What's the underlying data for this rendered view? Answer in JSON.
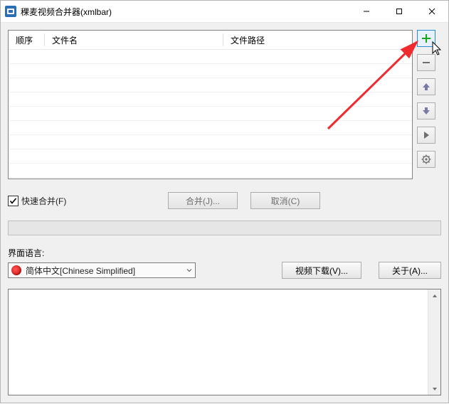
{
  "window": {
    "title": "稞麦视频合并器(xmlbar)"
  },
  "listview": {
    "columns": {
      "order": "顺序",
      "name": "文件名",
      "path": "文件路径"
    },
    "rows": []
  },
  "side_tools": {
    "add": "add-icon",
    "remove": "remove-icon",
    "move_up": "arrow-up-icon",
    "move_down": "arrow-down-icon",
    "play": "play-icon",
    "settings": "gear-icon"
  },
  "actions": {
    "fast_merge_label": "快速合并(F)",
    "fast_merge_checked": true,
    "merge_button": "合并(J)...",
    "cancel_button": "取消(C)"
  },
  "language": {
    "label": "界面语言:",
    "selected": "简体中文[Chinese Simplified]"
  },
  "bottom_buttons": {
    "video_download": "视频下载(V)...",
    "about": "关于(A)..."
  },
  "colors": {
    "accent": "#2a8dd4",
    "plus_green": "#17a81a",
    "arrow_red": "#ef2b2f"
  }
}
